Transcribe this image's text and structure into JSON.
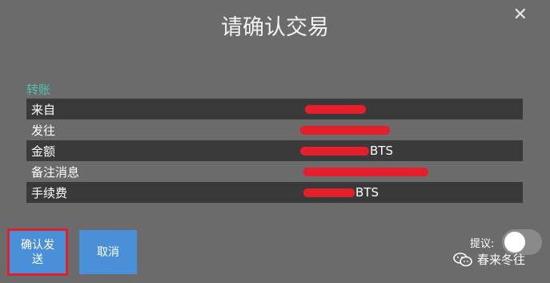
{
  "dialog": {
    "title": "请确认交易",
    "close_glyph": "✕"
  },
  "section": {
    "label": "转账"
  },
  "rows": [
    {
      "label": "来自",
      "unit": ""
    },
    {
      "label": "发往",
      "unit": ""
    },
    {
      "label": "金额",
      "unit": "BTS"
    },
    {
      "label": "备注消息",
      "unit": ""
    },
    {
      "label": "手续费",
      "unit": "BTS"
    }
  ],
  "buttons": {
    "confirm": "确认发\n送",
    "cancel": "取消"
  },
  "propose": {
    "label": "提议:",
    "enabled": false
  },
  "watermark": {
    "text": "春来冬往",
    "icon": "wechat-icon"
  },
  "colors": {
    "background": "#6b6b6b",
    "row_dark": "#3a3a3a",
    "section_accent": "#4fc3b3",
    "button": "#4a90d9",
    "redaction": "#e41e2b",
    "highlight_border": "#e0212c"
  }
}
